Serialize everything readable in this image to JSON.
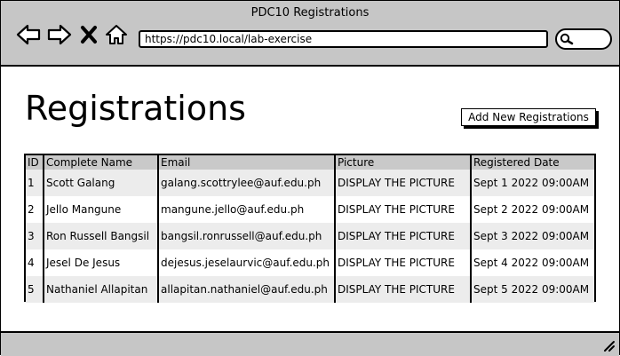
{
  "window": {
    "title": "PDC10 Registrations"
  },
  "toolbar": {
    "url": "https://pdc10.local/lab-exercise",
    "icons": [
      "back-arrow-icon",
      "forward-arrow-icon",
      "close-icon",
      "home-icon",
      "search-icon"
    ]
  },
  "page": {
    "title": "Registrations",
    "add_button": "Add New Registrations"
  },
  "table": {
    "columns": [
      "ID",
      "Complete Name",
      "Email",
      "Picture",
      "Registered Date"
    ],
    "rows": [
      {
        "id": "1",
        "name": "Scott Galang",
        "email": "galang.scottrylee@auf.edu.ph",
        "picture": "DISPLAY THE PICTURE",
        "date": "Sept 1 2022 09:00AM"
      },
      {
        "id": "2",
        "name": "Jello Mangune",
        "email": "mangune.jello@auf.edu.ph",
        "picture": "DISPLAY THE PICTURE",
        "date": "Sept 2 2022 09:00AM"
      },
      {
        "id": "3",
        "name": "Ron Russell Bangsil",
        "email": "bangsil.ronrussell@auf.edu.ph",
        "picture": "DISPLAY THE PICTURE",
        "date": "Sept 3 2022 09:00AM"
      },
      {
        "id": "4",
        "name": "Jesel De Jesus",
        "email": "dejesus.jeselaurvic@auf.edu.ph",
        "picture": "DISPLAY THE PICTURE",
        "date": "Sept 4 2022 09:00AM"
      },
      {
        "id": "5",
        "name": "Nathaniel Allapitan",
        "email": "allapitan.nathaniel@auf.edu.ph",
        "picture": "DISPLAY THE PICTURE",
        "date": "Sept 5 2022 09:00AM"
      }
    ]
  },
  "statusbar": {
    "icon": "resize-grip-icon"
  }
}
